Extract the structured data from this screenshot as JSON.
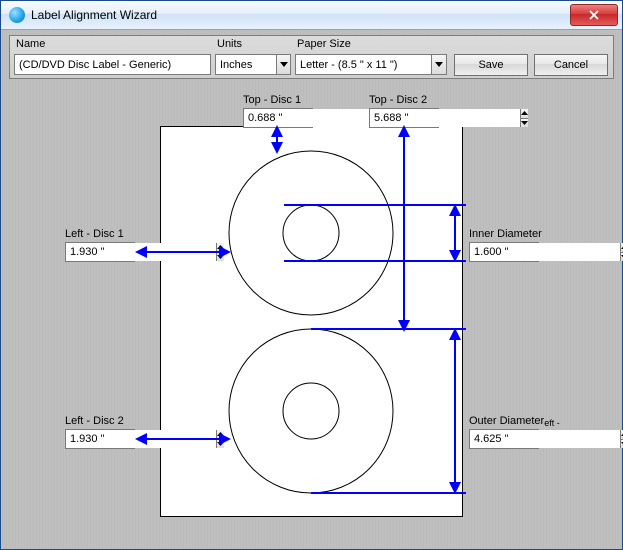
{
  "window": {
    "title": "Label Alignment Wizard"
  },
  "toolbar": {
    "name_label": "Name",
    "name_value": "(CD/DVD Disc Label - Generic)",
    "units_label": "Units",
    "units_value": "Inches",
    "paper_label": "Paper Size",
    "paper_value": "Letter - (8.5 \" x 11 \")",
    "save": "Save",
    "cancel": "Cancel"
  },
  "fields": {
    "top1_label": "Top - Disc 1",
    "top1_value": "0.688 \"",
    "top2_label": "Top - Disc 2",
    "top2_value": "5.688 \"",
    "left1_label": "Left - Disc 1",
    "left1_value": "1.930 \"",
    "left2_label": "Left - Disc 2",
    "left2_value": "1.930 \"",
    "inner_label": "Inner Diameter",
    "inner_value": "1.600 \"",
    "outer_label": "Outer Diameter",
    "outer_fragment": "eft - ",
    "outer_value": "4.625 \""
  }
}
